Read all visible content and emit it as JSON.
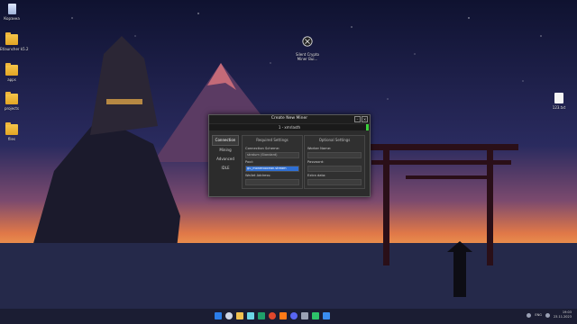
{
  "desktop": {
    "icons": [
      {
        "label": "Корзина",
        "type": "bin"
      },
      {
        "label": "Etlauncher k5.2",
        "type": "folder"
      },
      {
        "label": "apps",
        "type": "folder"
      },
      {
        "label": "projects",
        "type": "folder"
      },
      {
        "label": "files",
        "type": "folder"
      },
      {
        "label": "Silent Crypto\nMiner Bui...",
        "type": "app"
      },
      {
        "label": "123.txt",
        "type": "file"
      }
    ]
  },
  "window": {
    "title": "Create New Miner",
    "subtitle": "1 - xmrlasth",
    "sidebar": [
      "Connection",
      "Mining",
      "Advanced",
      "IDLE"
    ],
    "required": {
      "heading": "Required Settings",
      "scheme_label": "Connection Scheme:",
      "scheme_value": "stratum (Standard)",
      "pool_label": "Pool:",
      "pool_value": "gu_moneroocean.stream",
      "wallet_label": "Wallet Address:"
    },
    "optional": {
      "heading": "Optional Settings",
      "worker_label": "Worker Name:",
      "password_label": "Password:",
      "extra_label": "Extra data:"
    }
  },
  "taskbar": {
    "lang": "ENG",
    "time": "19:03",
    "date": "23.11.2023",
    "app_colors": [
      "#2b7de9",
      "#cfd6e6",
      "#f2c04e",
      "#6bd6e6",
      "#1f9f6a",
      "#e0472c",
      "#ff7a17",
      "#5865f2",
      "#9aa0b4",
      "#2dc36a",
      "#3a8df0"
    ]
  },
  "colors": {
    "accent_green": "#3bd13b",
    "selection_blue": "#2f6fd3"
  }
}
